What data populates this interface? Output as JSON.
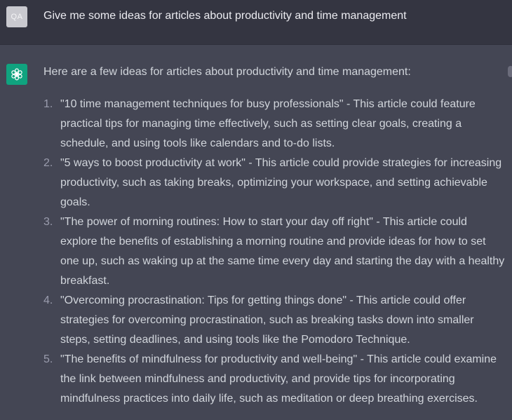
{
  "user": {
    "avatar_text": "QA",
    "message": "Give me some ideas for articles about productivity and time management"
  },
  "assistant": {
    "avatar_icon": "openai-logo-icon",
    "intro": "Here are a few ideas for articles about productivity and time management:",
    "items": [
      {
        "number": "1.",
        "text": "\"10 time management techniques for busy professionals\" - This article could feature practical tips for managing time effectively, such as setting clear goals, creating a schedule, and using tools like calendars and to-do lists."
      },
      {
        "number": "2.",
        "text": "\"5 ways to boost productivity at work\" - This article could provide strategies for increasing productivity, such as taking breaks, optimizing your workspace, and setting achievable goals."
      },
      {
        "number": "3.",
        "text": "\"The power of morning routines: How to start your day off right\" - This article could explore the benefits of establishing a morning routine and provide ideas for how to set one up, such as waking up at the same time every day and starting the day with a healthy breakfast."
      },
      {
        "number": "4.",
        "text": "\"Overcoming procrastination: Tips for getting things done\" - This article could offer strategies for overcoming procrastination, such as breaking tasks down into smaller steps, setting deadlines, and using tools like the Pomodoro Technique."
      },
      {
        "number": "5.",
        "text": "\"The benefits of mindfulness for productivity and well-being\" - This article could examine the link between mindfulness and productivity, and provide tips for incorporating mindfulness practices into daily life, such as meditation or deep breathing exercises."
      }
    ]
  },
  "colors": {
    "user_row_bg": "#343541",
    "assistant_row_bg": "#444654",
    "brand_green": "#10a37f",
    "text": "#d1d5db"
  }
}
